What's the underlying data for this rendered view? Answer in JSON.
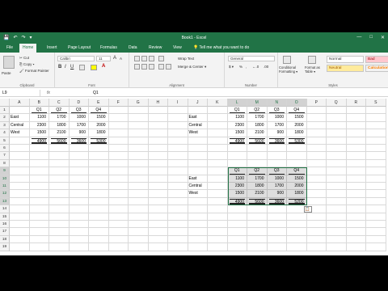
{
  "window": {
    "title": "Book1 - Excel",
    "qat": [
      "💾",
      "↶",
      "↷",
      "▾"
    ],
    "controls": [
      "—",
      "□",
      "✕"
    ]
  },
  "tabs": [
    "File",
    "Home",
    "Insert",
    "Page Layout",
    "Formulas",
    "Data",
    "Review",
    "View",
    "💡 Tell me what you want to do"
  ],
  "ribbon": {
    "clipboard": {
      "paste": "Paste",
      "cut": "✂ Cut",
      "copy": "⎘ Copy ▾",
      "format_painter": "🖌 Format Painter",
      "label": "Clipboard"
    },
    "font": {
      "name": "Calibri",
      "size": "11",
      "bold": "B",
      "italic": "I",
      "underline": "U",
      "label": "Font",
      "grow": "A",
      "shrink": "A",
      "fill_letter": "A"
    },
    "alignment": {
      "wrap": "Wrap Text",
      "merge": "Merge & Center ▾",
      "label": "Alignment"
    },
    "number": {
      "format": "General",
      "currency": "$ ▾",
      "percent": "%",
      "comma": ",",
      "inc_dec": "←.0",
      "dec_dec": ".00",
      "label": "Number"
    },
    "styles": {
      "cond": "Conditional Formatting ▾",
      "table": "Format as Table ▾",
      "normal": "Normal",
      "bad": "Bad",
      "neutral": "Neutral",
      "calc": "Calculation",
      "label": "Styles"
    },
    "colors": {
      "accent": "#217346",
      "bad_bg": "#ffc7ce",
      "bad_fg": "#9c0006",
      "neutral_bg": "#ffeb9c",
      "neutral_fg": "#9c5700",
      "calc_bg": "#f2f2f2",
      "calc_fg": "#fa7d00"
    }
  },
  "formula_bar": {
    "name_box": "L9",
    "fx": "fx",
    "content": "Q1"
  },
  "columns": [
    "A",
    "B",
    "C",
    "D",
    "E",
    "F",
    "G",
    "H",
    "I",
    "J",
    "K",
    "L",
    "M",
    "N",
    "O",
    "P",
    "Q",
    "R",
    "S"
  ],
  "rows": [
    "1",
    "2",
    "3",
    "4",
    "5",
    "6",
    "7",
    "8",
    "9",
    "10",
    "11",
    "12",
    "13",
    "14",
    "15",
    "16",
    "17",
    "18",
    "19"
  ],
  "table1": {
    "headers": [
      "Q1",
      "Q2",
      "Q3",
      "Q4"
    ],
    "labels": [
      "East",
      "Central",
      "West",
      ""
    ],
    "values": [
      [
        "1100",
        "1700",
        "1000",
        "1500"
      ],
      [
        "2300",
        "1800",
        "1700",
        "2000"
      ],
      [
        "1500",
        "2100",
        "900",
        "1800"
      ],
      [
        "4900",
        "5600",
        "3600",
        "5300"
      ]
    ]
  },
  "table2": {
    "headers": [
      "Q1",
      "Q2",
      "Q3",
      "Q4"
    ],
    "labels": [
      "East",
      "Central",
      "West",
      ""
    ],
    "values": [
      [
        "1100",
        "1700",
        "1000",
        "1500"
      ],
      [
        "2300",
        "1800",
        "1700",
        "2000"
      ],
      [
        "1500",
        "2100",
        "900",
        "1800"
      ],
      [
        "4900",
        "5600",
        "3600",
        "5300"
      ]
    ]
  },
  "table3": {
    "headers": [
      "Q1",
      "Q2",
      "Q3",
      "Q4"
    ],
    "labels": [
      "East",
      "Central",
      "West",
      ""
    ],
    "values": [
      [
        "1100",
        "1700",
        "1000",
        "1500"
      ],
      [
        "2300",
        "1800",
        "1700",
        "2000"
      ],
      [
        "1500",
        "2100",
        "900",
        "1800"
      ],
      [
        "4900",
        "5600",
        "3600",
        "5200"
      ]
    ]
  },
  "paste_options_icon": "📋"
}
